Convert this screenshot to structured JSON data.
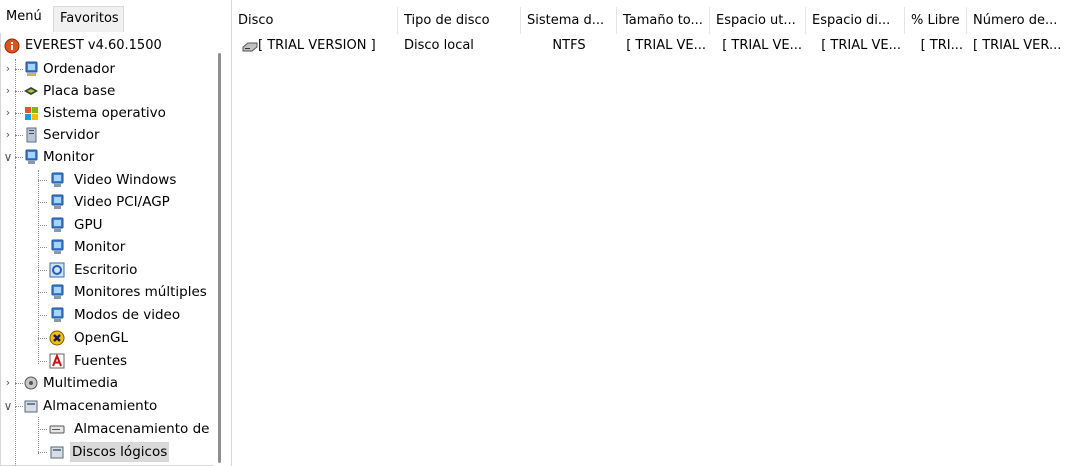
{
  "tabs": {
    "menu": "Menú",
    "favorites": "Favoritos"
  },
  "tree": {
    "root": "EVEREST v4.60.1500",
    "items": [
      {
        "label": "Ordenador",
        "icon": "computer-icon"
      },
      {
        "label": "Placa base",
        "icon": "motherboard-icon"
      },
      {
        "label": "Sistema operativo",
        "icon": "windows-logo-icon"
      },
      {
        "label": "Servidor",
        "icon": "server-icon"
      },
      {
        "label": "Monitor",
        "icon": "monitor-icon"
      },
      {
        "label": "Video Windows",
        "icon": "display-icon"
      },
      {
        "label": "Video PCI/AGP",
        "icon": "display-icon"
      },
      {
        "label": "GPU",
        "icon": "display-icon"
      },
      {
        "label": "Monitor",
        "icon": "display-icon"
      },
      {
        "label": "Escritorio",
        "icon": "desktop-icon"
      },
      {
        "label": "Monitores múltiples",
        "icon": "display-icon"
      },
      {
        "label": "Modos de video",
        "icon": "display-icon"
      },
      {
        "label": "OpenGL",
        "icon": "opengl-icon"
      },
      {
        "label": "Fuentes",
        "icon": "fonts-icon"
      },
      {
        "label": "Multimedia",
        "icon": "multimedia-icon"
      },
      {
        "label": "Almacenamiento",
        "icon": "storage-icon"
      },
      {
        "label": "Almacenamiento de",
        "icon": "drive-icon"
      },
      {
        "label": "Discos lógicos",
        "icon": "logical-disk-icon"
      }
    ]
  },
  "table": {
    "columns": [
      "Disco",
      "Tipo de disco",
      "Sistema d...",
      "Tamaño to...",
      "Espacio ut...",
      "Espacio di...",
      "% Libre",
      "Número de..."
    ],
    "rows": [
      [
        "[ TRIAL VERSION ]",
        "Disco local",
        "NTFS",
        "[ TRIAL VE...",
        "[ TRIAL VE...",
        "[ TRIAL VE...",
        "[ TRI...",
        "[ TRIAL VER..."
      ]
    ]
  },
  "colors": {
    "selection": "#d9d9d9",
    "border": "#d6d6d6"
  }
}
